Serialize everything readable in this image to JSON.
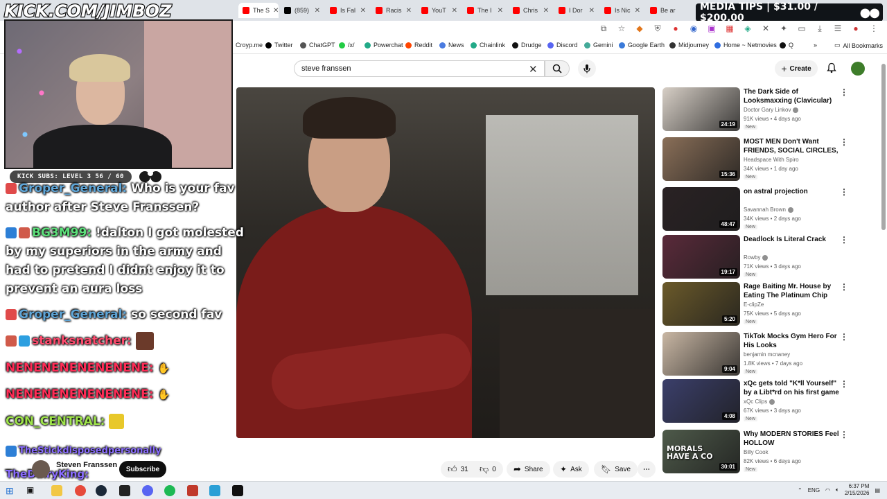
{
  "tabs": [
    {
      "title": "The S",
      "icon": "youtube-icon",
      "active": true
    },
    {
      "title": "(859)",
      "icon": "x-icon"
    },
    {
      "title": "Is Fal",
      "icon": "youtube-icon"
    },
    {
      "title": "Racis",
      "icon": "youtube-icon"
    },
    {
      "title": "YouT",
      "icon": "youtube-icon"
    },
    {
      "title": "The I",
      "icon": "youtube-icon"
    },
    {
      "title": "Chris",
      "icon": "youtube-icon"
    },
    {
      "title": "I Dor",
      "icon": "youtube-icon"
    },
    {
      "title": "Is Nic",
      "icon": "youtube-icon"
    },
    {
      "title": "Be ar",
      "icon": "youtube-icon"
    }
  ],
  "overlay": {
    "stream_url": "KICK.COM/JIMBOZ",
    "media_tips": "MEDIA TIPS | $31.00 / $200.00",
    "kick_subs": "KICK SUBS: LEVEL 3 56 / 60"
  },
  "bookmarks": [
    {
      "label": "Croyp.me"
    },
    {
      "label": "Twitter"
    },
    {
      "label": "ChatGPT"
    },
    {
      "label": "/x/"
    },
    {
      "label": "Powerchat"
    },
    {
      "label": "Reddit"
    },
    {
      "label": "News"
    },
    {
      "label": "Chainlink"
    },
    {
      "label": "Drudge"
    },
    {
      "label": "Discord"
    },
    {
      "label": "Gemini"
    },
    {
      "label": "Google Earth"
    },
    {
      "label": "Midjourney"
    },
    {
      "label": "Home ~ Netmovies"
    },
    {
      "label": "Q"
    },
    {
      "label": "All Bookmarks"
    }
  ],
  "search": {
    "query": "steve franssen"
  },
  "masthead": {
    "create_label": "Create"
  },
  "chat": [
    {
      "user": "Groper_General:",
      "message": "Who is your fav author after Steve Franssen?"
    },
    {
      "user": "BG3M99:",
      "message": "!dalton I got molested by my superiors in the army and had to pretend I didnt enjoy it to prevent an aura loss"
    },
    {
      "user": "Groper_General:",
      "message": "so second fav"
    },
    {
      "user": "stanksnatcher:",
      "message": ""
    },
    {
      "user": "NENENENENENENENE:",
      "message": ""
    },
    {
      "user": "NENENENENENENENE:",
      "message": ""
    },
    {
      "user": "CON_CENTRAL:",
      "message": ""
    },
    {
      "user": "TheStickdisposedpersonally",
      "message": ""
    },
    {
      "user": "TheDairyKing:",
      "message": ""
    }
  ],
  "video": {
    "channel": "Steven Franssen",
    "subscribe_label": "Subscribe",
    "likes": "31",
    "dislikes": "0",
    "share_label": "Share",
    "ask_label": "Ask",
    "save_label": "Save"
  },
  "related": [
    {
      "title": "The Dark Side of Looksmaxxing (Clavicular)",
      "channel": "Doctor Gary Linkov",
      "verified": true,
      "meta": "91K views • 4 days ago",
      "duration": "24:19",
      "badge": "New",
      "thumb_color": "#d7cfc6"
    },
    {
      "title": "MOST MEN Don't Want FRIENDS, SOCIAL CIRCLES, or...",
      "channel": "Headspace With Spiro",
      "verified": false,
      "meta": "34K views • 1 day ago",
      "duration": "15:36",
      "badge": "New",
      "thumb_color": "#8a6f58"
    },
    {
      "title": "on astral projection",
      "channel": "Savannah Brown",
      "verified": true,
      "meta": "34K views • 2 days ago",
      "duration": "48:47",
      "badge": "New",
      "thumb_color": "#2a2224"
    },
    {
      "title": "Deadlock Is Literal Crack",
      "channel": "Rowby",
      "verified": true,
      "meta": "71K views • 3 days ago",
      "duration": "19:17",
      "badge": "New",
      "thumb_color": "#5a2a3a"
    },
    {
      "title": "Rage Baiting Mr. House by Eating The Platinum Chip",
      "channel": "E-clipZe",
      "verified": false,
      "meta": "75K views • 5 days ago",
      "duration": "5:20",
      "badge": "New",
      "thumb_color": "#6b5a2a"
    },
    {
      "title": "TikTok Mocks Gym Hero For His Looks",
      "channel": "benjamin mcnaney",
      "verified": false,
      "meta": "1.8K views • 7 days ago",
      "duration": "9:04",
      "badge": "New",
      "thumb_color": "#c9b7a4"
    },
    {
      "title": "xQc gets told \"K*ll Yourself\" by a Libt*rd on his first game bac...",
      "channel": "xQc Clips",
      "verified": true,
      "meta": "67K views • 3 days ago",
      "duration": "4:08",
      "badge": "New",
      "thumb_color": "#3b3f6b"
    },
    {
      "title": "Why MODERN STORIES Feel HOLLOW",
      "channel": "Billy Cook",
      "verified": false,
      "meta": "82K views • 6 days ago",
      "duration": "30:01",
      "badge": "New",
      "thumb_color": "#4e5a4a",
      "thumb_text": "MORALS HAVE A CO"
    }
  ],
  "taskbar": {
    "lang": "ENG",
    "time": "6:37 PM",
    "date": "2/15/2026"
  }
}
